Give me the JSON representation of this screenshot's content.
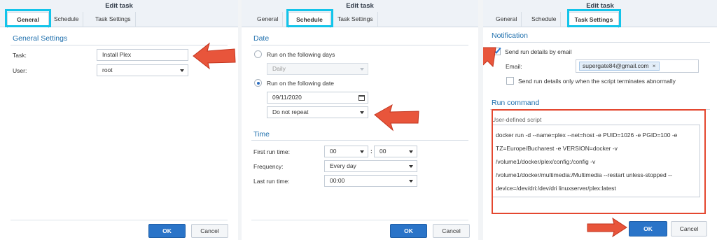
{
  "panel1": {
    "title": "Edit task",
    "tabs": [
      "General",
      "Schedule",
      "Task Settings"
    ],
    "section_title": "General Settings",
    "task_label": "Task:",
    "task_value": "Install Plex",
    "user_label": "User:",
    "user_value": "root",
    "ok": "OK",
    "cancel": "Cancel"
  },
  "panel2": {
    "title": "Edit task",
    "tabs": [
      "General",
      "Schedule",
      "Task Settings"
    ],
    "date_section": "Date",
    "opt_days": "Run on the following days",
    "days_value": "Daily",
    "opt_date": "Run on the following date",
    "date_value": "09/11/2020",
    "repeat_value": "Do not repeat",
    "time_section": "Time",
    "first_run_label": "First run time:",
    "first_run_hour": "00",
    "first_run_colon": ":",
    "first_run_min": "00",
    "frequency_label": "Frequency:",
    "frequency_value": "Every day",
    "last_run_label": "Last run time:",
    "last_run_value": "00:00",
    "ok": "OK",
    "cancel": "Cancel"
  },
  "panel3": {
    "title": "Edit task",
    "tabs": [
      "General",
      "Schedule",
      "Task Settings"
    ],
    "notification_section": "Notification",
    "send_details": "Send run details by email",
    "email_label": "Email:",
    "email_chip": "supergate84@gmail.com",
    "chip_remove": "×",
    "abnormal_only": "Send run details only when the script terminates abnormally",
    "run_command_section": "Run command",
    "script_label": "User-defined script",
    "script": "docker run -d --name=plex --net=host -e PUID=1026 -e PGID=100 -e\nTZ=Europe/Bucharest -e VERSION=docker -v\n/volume1/docker/plex/config:/config -v\n/volume1/docker/multimedia:/Multimedia --restart unless-stopped --\ndevice=/dev/dri:/dev/dri linuxserver/plex:latest",
    "ok": "OK",
    "cancel": "Cancel"
  },
  "colors": {
    "accent": "#2a74c8",
    "section": "#1e6fad",
    "highlight": "#12c4ea",
    "annotation": "#e4472f"
  }
}
